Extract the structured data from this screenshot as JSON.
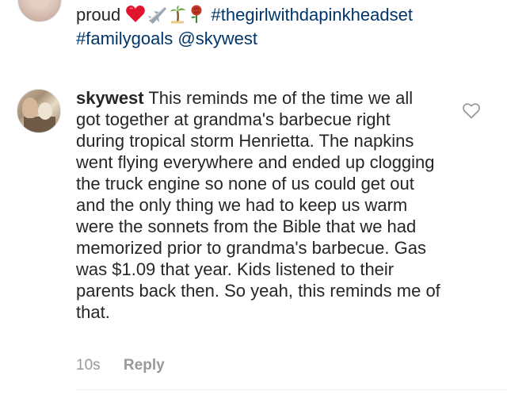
{
  "caption": {
    "line1_text": "proud",
    "line1_emojis": [
      "heart-emoji",
      "airplane-emoji",
      "palm-tree-emoji",
      "rose-emoji"
    ],
    "line1_hashtag": "#thegirlwithdapinkheadset",
    "line2_hashtag": "#familygoals",
    "line2_mention": "@skywest"
  },
  "comment": {
    "username": "skywest",
    "text": "This reminds me of the time we all got together at grandma's barbecue right during tropical storm Henrietta. The napkins went flying everywhere and ended up clogging the truck engine so none of us could get out and the only thing we had to keep us warm were the sonnets from the Bible that we had memorized prior to grandma's barbecue. Gas was $1.09 that year. Kids listened to their parents back then. So yeah, this reminds me of that.",
    "timestamp": "10s",
    "reply_label": "Reply",
    "like_icon": "heart-outline-icon"
  },
  "colors": {
    "text": "#262626",
    "link": "#003569",
    "meta": "#999999",
    "icon": "#999999",
    "divider": "#efefef"
  }
}
